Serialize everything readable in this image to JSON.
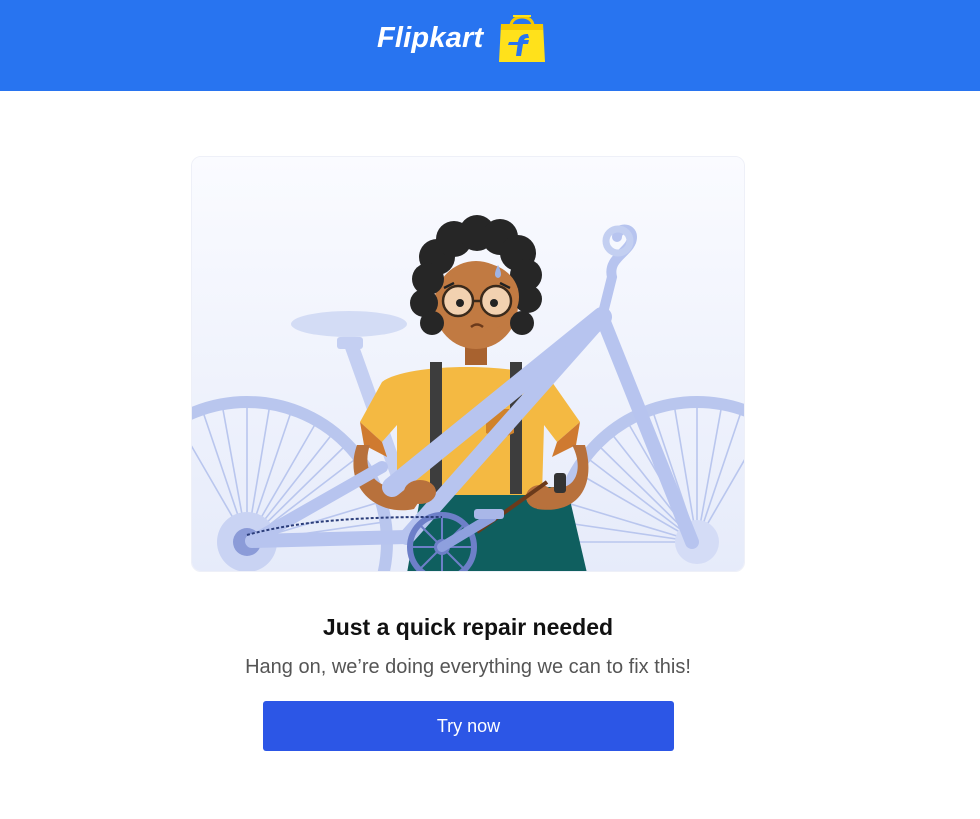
{
  "header": {
    "brand_name": "Flipkart",
    "logo_icon": "flipkart-bag-icon",
    "background_color": "#2874f0"
  },
  "illustration": {
    "icon": "bicycle-repair-illustration"
  },
  "message": {
    "title": "Just a quick repair needed",
    "subtitle": "Hang on, we’re doing everything we can to fix this!"
  },
  "actions": {
    "try_now_label": "Try now",
    "button_color": "#2c56e6"
  }
}
